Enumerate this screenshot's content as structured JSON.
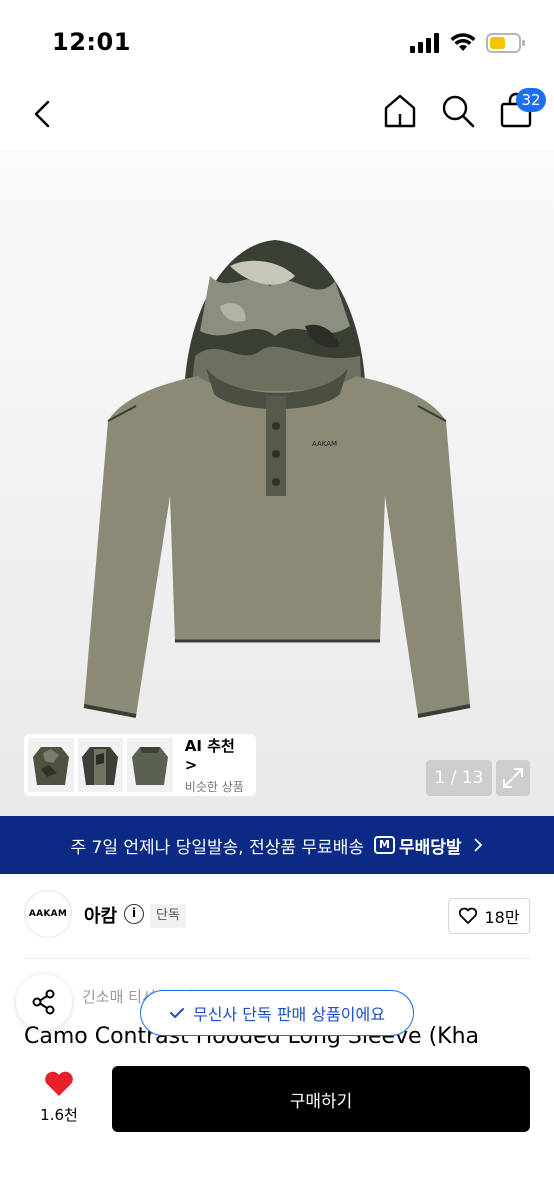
{
  "status": {
    "time": "12:01"
  },
  "nav": {
    "cart_count": "32"
  },
  "gallery": {
    "counter": "1 / 13",
    "product_logo_text": "AAKAM"
  },
  "ai_recommend": {
    "title": "AI 추천 >",
    "subtitle": "비슷한 상품"
  },
  "banner": {
    "text": "주 7일 언제나 당일발송, 전상품 무료배송",
    "badge_mark": "M",
    "badge_label": "무배당발",
    "accent": "#0a2a86"
  },
  "brand": {
    "logo_text": "AAKAM",
    "name": "아캄",
    "tag": "단독",
    "likes": "18만"
  },
  "info": {
    "sub_line": "긴소매 티셔츠 (아캄)",
    "exclusive_notice": "무신사 단독 판매 상품이에요",
    "title": "Camo Contrast Hooded Long Sleeve (Kha"
  },
  "bottom": {
    "wish_count": "1.6천",
    "buy_label": "구매하기"
  },
  "colors": {
    "like_red": "#e8202a",
    "badge_blue": "#1d6ff2",
    "buy_black": "#000000"
  }
}
